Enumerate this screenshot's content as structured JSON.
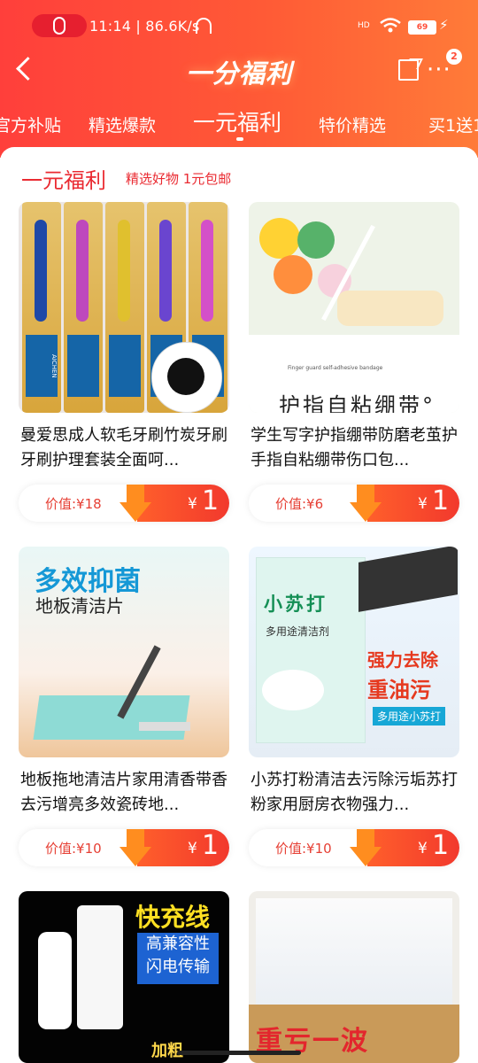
{
  "status_bar": {
    "time_speed": "11:14 | 86.6K/s",
    "signal_label": "HD",
    "battery": "69"
  },
  "header": {
    "title": "一分福利",
    "badge_count": "2"
  },
  "tabs": [
    {
      "label": "官方补贴"
    },
    {
      "label": "精选爆款"
    },
    {
      "label": "一元福利"
    },
    {
      "label": "特价精选"
    },
    {
      "label": "买1送1"
    }
  ],
  "section": {
    "title": "一元福利",
    "subtitle": "精选好物 1元包邮"
  },
  "products": [
    {
      "name": "曼爱思成人软毛牙刷竹炭牙刷牙刷护理套装全面呵...",
      "value_label": "价值:¥18",
      "currency": "¥",
      "price": "1",
      "image_text": "AICHEN"
    },
    {
      "name": "学生写字护指绷带防磨老茧护手指自粘绷带伤口包...",
      "value_label": "价值:¥6",
      "currency": "¥",
      "price": "1",
      "image_text": "护指自粘绷带°",
      "image_small": "Finger guard self-adhesive bandage"
    },
    {
      "name": "地板拖地清洁片家用清香带香去污增亮多效瓷砖地...",
      "value_label": "价值:¥10",
      "currency": "¥",
      "price": "1",
      "image_title": "多效抑菌",
      "image_subtitle": "地板清洁片"
    },
    {
      "name": "小苏打粉清洁去污除污垢苏打粉家用厨房衣物强力...",
      "value_label": "价值:¥10",
      "currency": "¥",
      "price": "1",
      "image_label": "小苏打",
      "image_line1": "强力去除",
      "image_line2": "重油污",
      "image_tag": "多用途小苏打",
      "bag_text": "多用途清洁剂"
    },
    {
      "image_title": "快充线",
      "image_line1": "高兼容性",
      "image_line2": "闪电传输",
      "image_tag": "加粗"
    },
    {
      "image_title": "重亏一波"
    }
  ],
  "colors": {
    "header_start": "#ff3f3b",
    "header_end": "#ff7b38",
    "accent": "#ea2b32"
  }
}
